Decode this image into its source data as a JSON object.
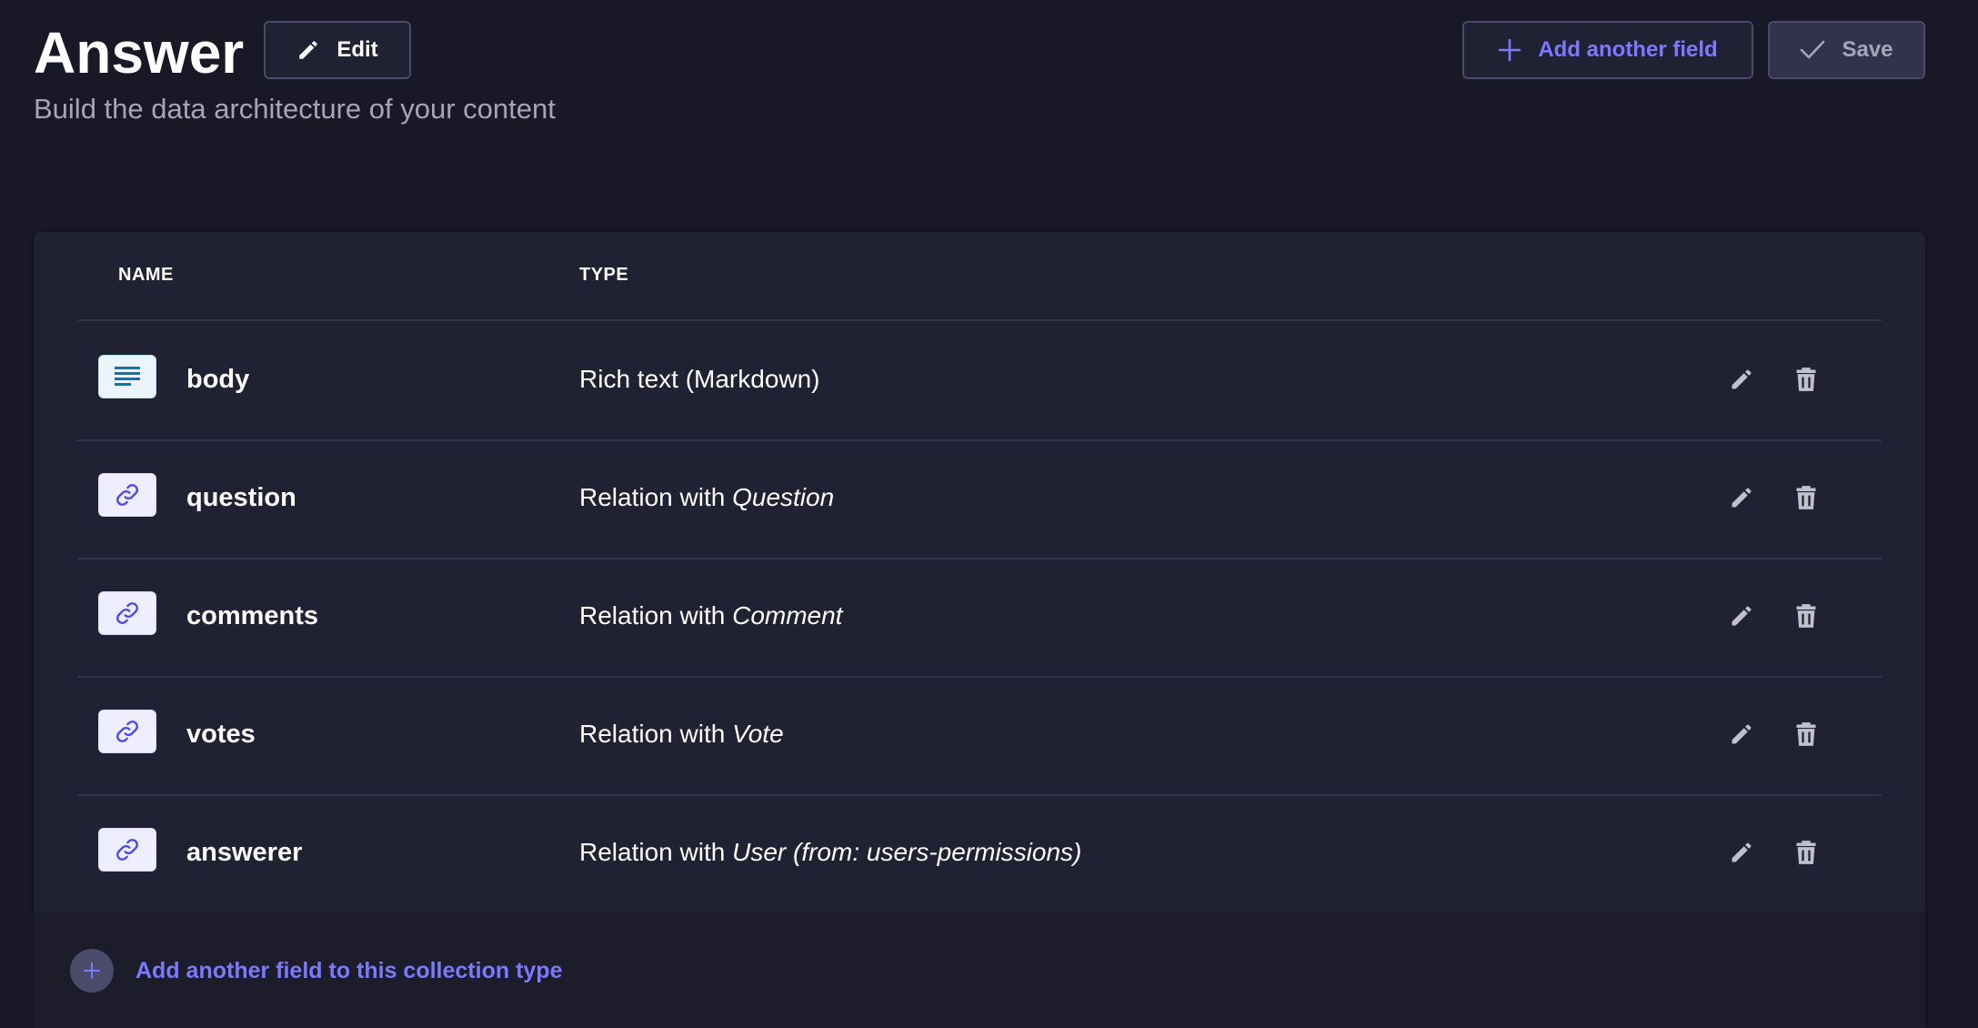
{
  "header": {
    "title": "Answer",
    "subtitle": "Build the data architecture of your content",
    "edit_label": "Edit",
    "add_field_label": "Add another field",
    "save_label": "Save"
  },
  "table": {
    "columns": [
      "NAME",
      "TYPE"
    ],
    "rows": [
      {
        "icon": "richtext-icon",
        "name": "body",
        "type_prefix": "Rich text (Markdown)",
        "type_target": ""
      },
      {
        "icon": "relation-icon",
        "name": "question",
        "type_prefix": "Relation with ",
        "type_target": "Question"
      },
      {
        "icon": "relation-icon",
        "name": "comments",
        "type_prefix": "Relation with ",
        "type_target": "Comment"
      },
      {
        "icon": "relation-icon",
        "name": "votes",
        "type_prefix": "Relation with ",
        "type_target": "Vote"
      },
      {
        "icon": "relation-icon",
        "name": "answerer",
        "type_prefix": "Relation with ",
        "type_target": "User (from: users-permissions)"
      }
    ]
  },
  "footer": {
    "add_label": "Add another field to this collection type"
  },
  "colors": {
    "background": "#181826",
    "card": "#212134",
    "accent": "#7b79ff",
    "divider": "#32324d"
  }
}
